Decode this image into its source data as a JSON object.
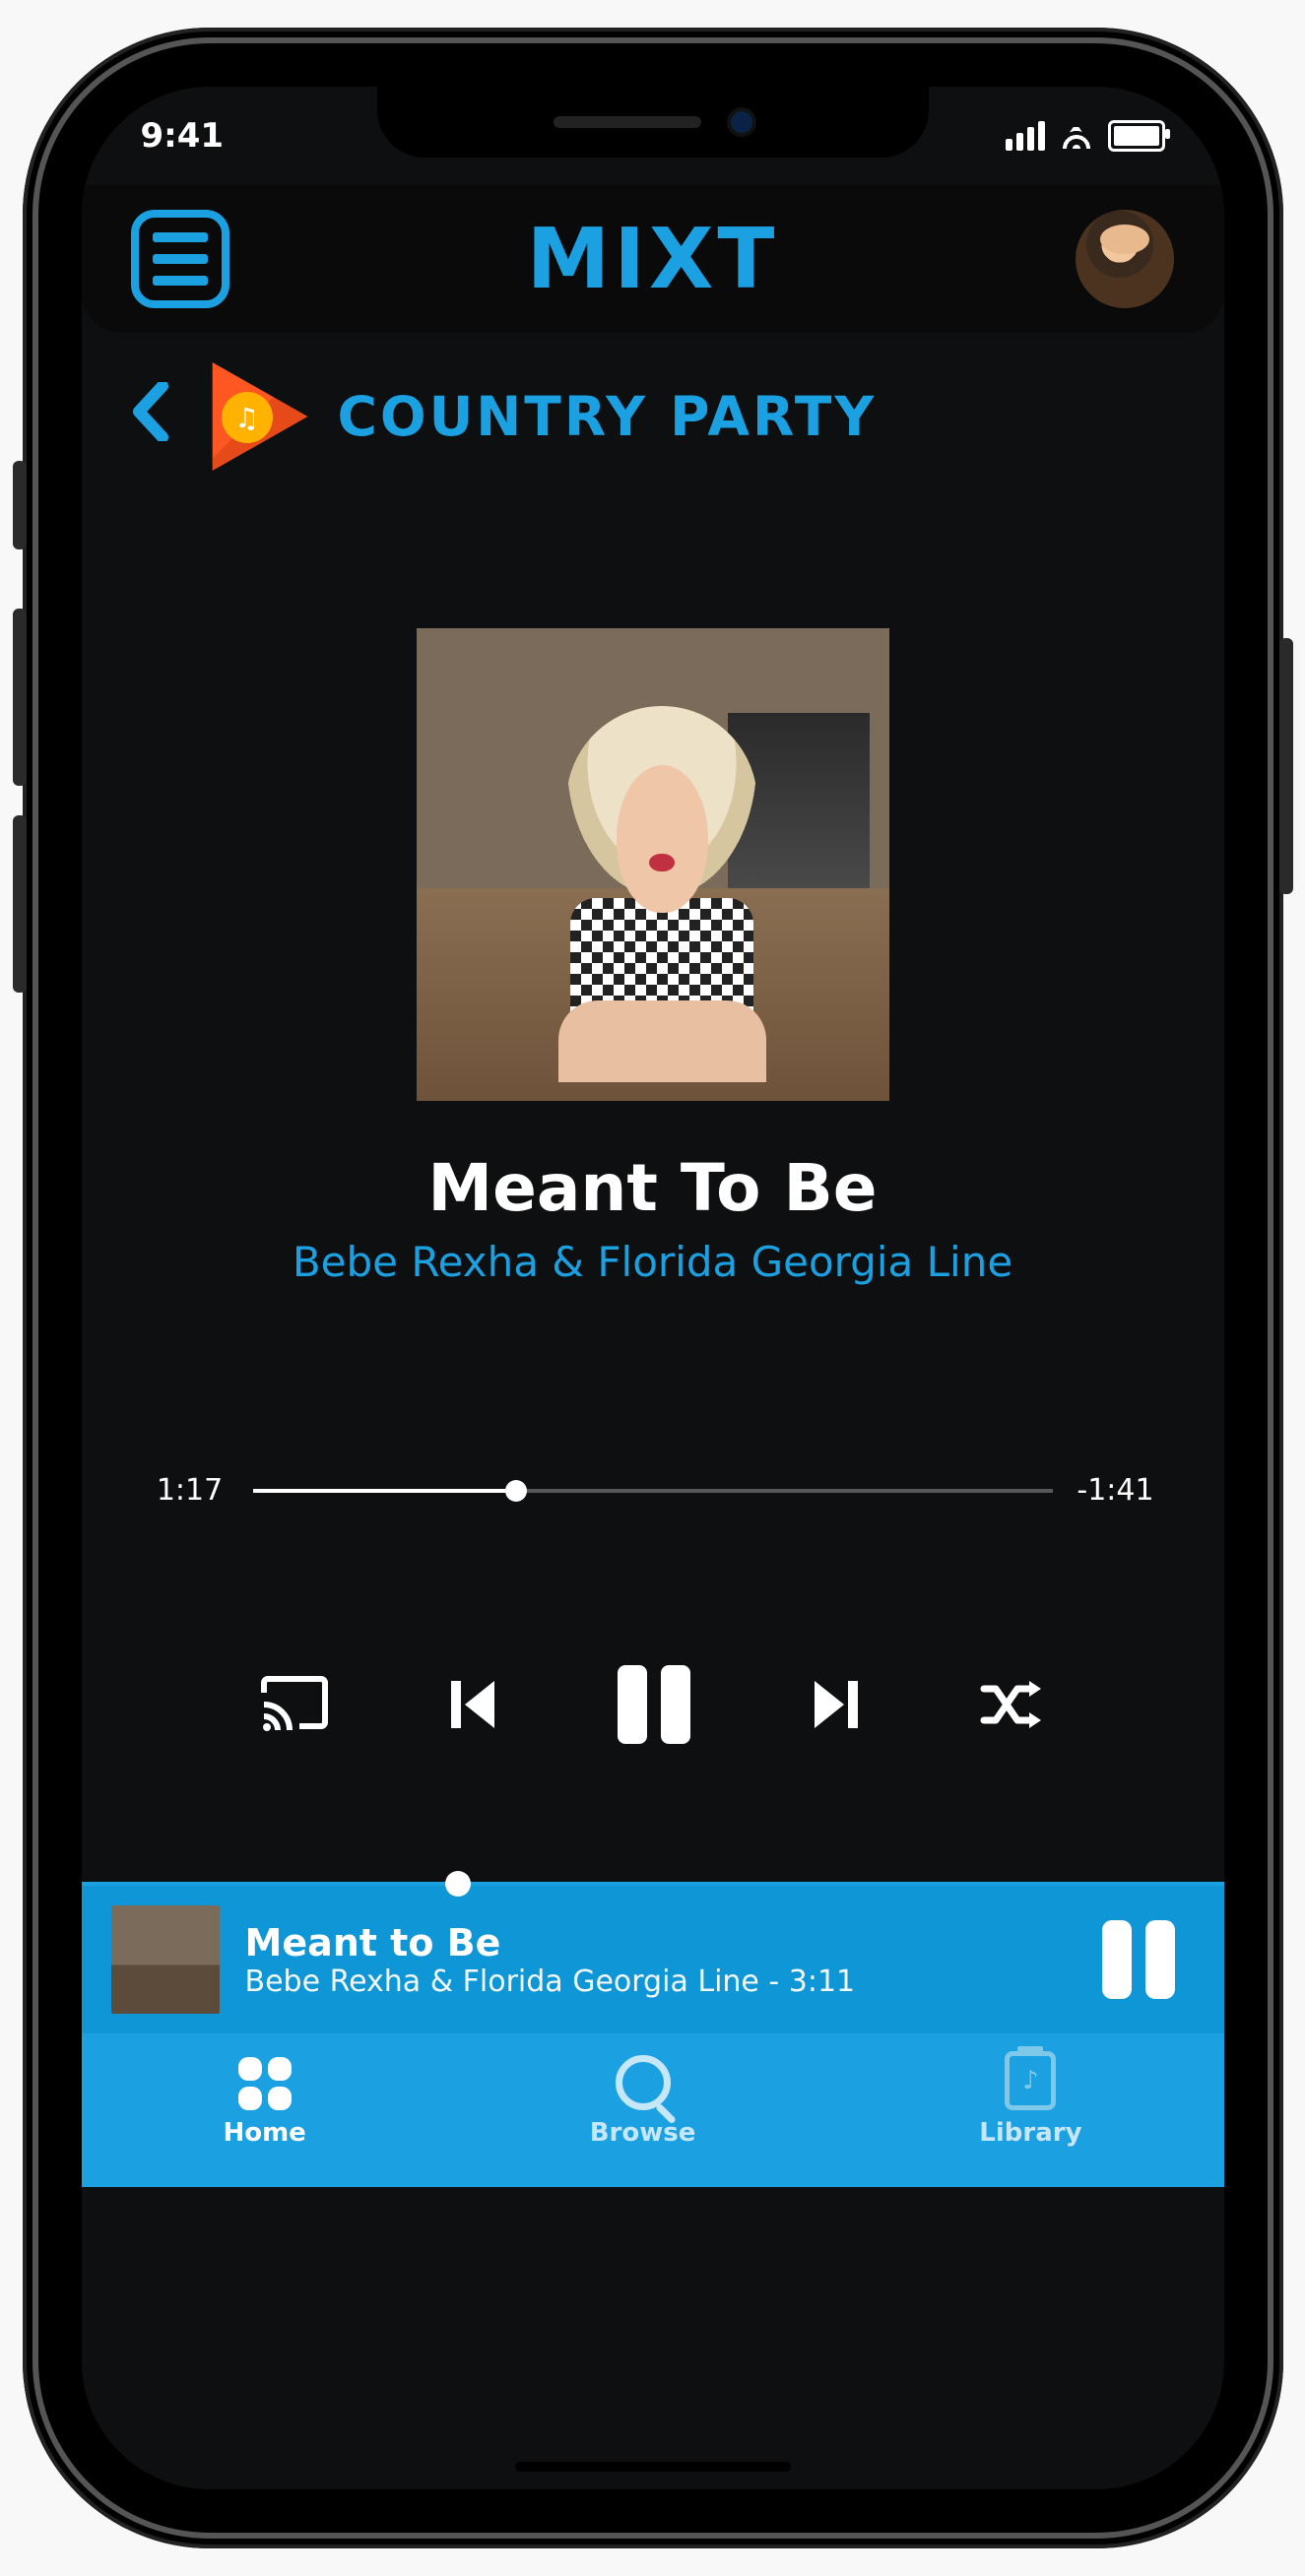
{
  "status": {
    "time": "9:41"
  },
  "header": {
    "logo": "MIXT"
  },
  "playlist": {
    "title": "COUNTRY PARTY",
    "source_icon": "google-play-music-icon"
  },
  "now_playing": {
    "title": "Meant To Be",
    "artist": "Bebe Rexha & Florida Georgia Line",
    "elapsed": "1:17",
    "remaining": "-1:41",
    "progress_pct": 33
  },
  "mini_player": {
    "title": "Meant to Be",
    "subtitle": "Bebe Rexha & Florida Georgia Line - 3:11"
  },
  "tabs": {
    "home": "Home",
    "browse": "Browse",
    "library": "Library"
  },
  "colors": {
    "accent": "#1BA1E2",
    "background": "#0E0F10"
  }
}
